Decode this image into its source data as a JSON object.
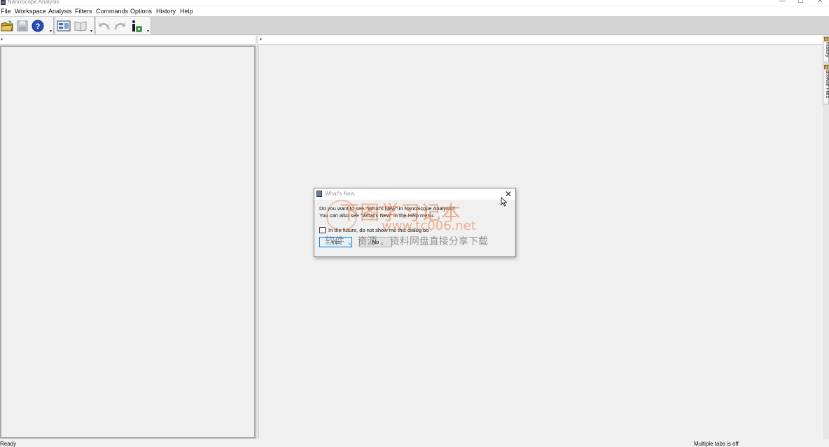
{
  "window": {
    "title": "NanoScope Analysis",
    "minimize_glyph": "—",
    "maximize_glyph": "☐",
    "close_glyph": "✕"
  },
  "menu": [
    "File",
    "Workspace",
    "Analysis",
    "Filters",
    "Commands",
    "Options",
    "History",
    "Help"
  ],
  "toolbar": {
    "icons": [
      "open-folder-icon",
      "save-disk-icon",
      "help-icon",
      "view-layout-icon",
      "book-icon",
      "undo-icon",
      "redo-icon",
      "info-tool-icon"
    ],
    "overflow_glyph": "▾"
  },
  "panels": {
    "left_dropdown_glyph": "▾",
    "right_dropdown_glyph": "▾"
  },
  "side_tabs": [
    "History",
    "Browse Files"
  ],
  "statusbar": {
    "left": "Ready",
    "right": "Multiple tabs is off"
  },
  "dialog": {
    "title": "What's New",
    "close_glyph": "✕",
    "message": "Do you want to see \"What's New\" in NanoScope Analysis? You can also see \"What's New\" in the Help menu.",
    "checkbox_label": "In the future, do not show me this dialog bo",
    "checkbox_checked": false,
    "yes_label": "Yes",
    "no_label": "No"
  },
  "watermark": {
    "line1": "下图学习记本",
    "line2": "www.tc006.net",
    "line3": "软件 、资源 、资料网盘直接分享下载"
  }
}
